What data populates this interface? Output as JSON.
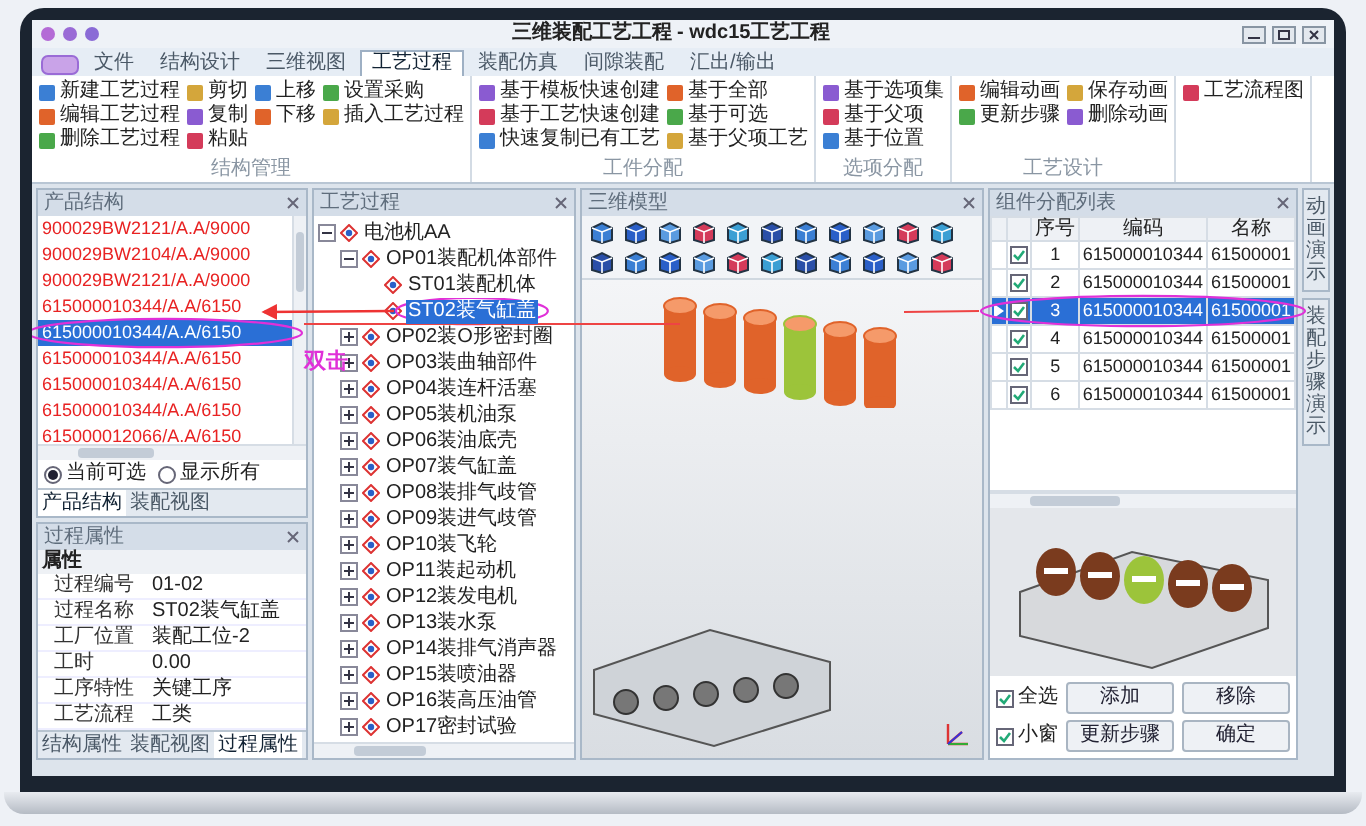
{
  "window": {
    "title": "三维装配工艺工程 - wdc15工艺工程"
  },
  "ribbon": {
    "tabs": [
      {
        "label": "文件",
        "selected": false
      },
      {
        "label": "结构设计",
        "selected": false
      },
      {
        "label": "三维视图",
        "selected": false
      },
      {
        "label": "工艺过程",
        "selected": true
      },
      {
        "label": "装配仿真",
        "selected": false
      },
      {
        "label": "间隙装配",
        "selected": false
      },
      {
        "label": "汇出/输出",
        "selected": false
      }
    ],
    "groups": [
      {
        "label": "结构管理",
        "columns": [
          [
            "新建工艺过程",
            "编辑工艺过程",
            "删除工艺过程"
          ],
          [
            "剪切",
            "复制",
            "粘贴"
          ],
          [
            "上移",
            "下移"
          ],
          [
            "设置采购",
            "插入工艺过程"
          ]
        ]
      },
      {
        "label": "工件分配",
        "columns": [
          [
            "基于模板快速创建",
            "基于工艺快速创建",
            "快速复制已有工艺"
          ],
          [
            "基于全部",
            "基于可选",
            "基于父项工艺"
          ]
        ]
      },
      {
        "label": "选项分配",
        "columns": [
          [
            "基于选项集",
            "基于父项",
            "基于位置"
          ]
        ]
      },
      {
        "label": "工艺设计",
        "columns": [
          [
            "编辑动画",
            "更新步骤"
          ],
          [
            "保存动画",
            "删除动画"
          ]
        ]
      },
      {
        "columns": [
          [
            "工艺流程图"
          ]
        ]
      }
    ]
  },
  "product_panel": {
    "title": "产品结构",
    "rows": [
      {
        "text": "900029BW2121/A.A/9000",
        "selected": false
      },
      {
        "text": "900029BW2104/A.A/9000",
        "selected": false
      },
      {
        "text": "900029BW2121/A.A/9000",
        "selected": false
      },
      {
        "text": "615000010344/A.A/6150",
        "selected": false
      },
      {
        "text": "615000010344/A.A/6150",
        "selected": true
      },
      {
        "text": "615000010344/A.A/6150",
        "selected": false
      },
      {
        "text": "615000010344/A.A/6150",
        "selected": false
      },
      {
        "text": "615000010344/A.A/6150",
        "selected": false
      },
      {
        "text": "615000012066/A.A/6150",
        "selected": false
      }
    ],
    "radios": [
      {
        "label": "当前可选",
        "selected": true
      },
      {
        "label": "显示所有",
        "selected": false
      }
    ],
    "tabs": [
      {
        "label": "产品结构",
        "selected": true
      },
      {
        "label": "装配视图",
        "selected": false
      }
    ]
  },
  "properties_panel": {
    "title": "过程属性",
    "category": "属性",
    "rows": [
      {
        "label": "过程编号",
        "value": "01-02"
      },
      {
        "label": "过程名称",
        "value": "ST02装气缸盖"
      },
      {
        "label": "工厂位置",
        "value": "装配工位-2"
      },
      {
        "label": "工时",
        "value": "0.00"
      },
      {
        "label": "工序特性",
        "value": "关键工序"
      },
      {
        "label": "工艺流程",
        "value": "工类"
      }
    ],
    "tabs": [
      {
        "label": "结构属性",
        "selected": false
      },
      {
        "label": "装配视图",
        "selected": false
      },
      {
        "label": "过程属性",
        "selected": true
      }
    ]
  },
  "process_panel": {
    "title": "工艺过程",
    "nodes": [
      {
        "label": "电池机AA",
        "expanded": true,
        "selected": false,
        "children": [
          {
            "label": "OP01装配机体部件",
            "expanded": true,
            "selected": false,
            "children": [
              {
                "label": "ST01装配机体",
                "selected": false
              },
              {
                "label": "ST02装气缸盖",
                "selected": true
              }
            ]
          },
          {
            "label": "OP02装O形密封圈",
            "expanded": false,
            "selected": false
          },
          {
            "label": "OP03装曲轴部件",
            "expanded": false,
            "selected": false
          },
          {
            "label": "OP04装连杆活塞",
            "expanded": false,
            "selected": false
          },
          {
            "label": "OP05装机油泵",
            "expanded": false,
            "selected": false
          },
          {
            "label": "OP06装油底壳",
            "expanded": false,
            "selected": false
          },
          {
            "label": "OP07装气缸盖",
            "expanded": false,
            "selected": false
          },
          {
            "label": "OP08装排气歧管",
            "expanded": false,
            "selected": false
          },
          {
            "label": "OP09装进气歧管",
            "expanded": false,
            "selected": false
          },
          {
            "label": "OP10装飞轮",
            "expanded": false,
            "selected": false
          },
          {
            "label": "OP11装起动机",
            "expanded": false,
            "selected": false
          },
          {
            "label": "OP12装发电机",
            "expanded": false,
            "selected": false
          },
          {
            "label": "OP13装水泵",
            "expanded": false,
            "selected": false
          },
          {
            "label": "OP14装排气消声器",
            "expanded": false,
            "selected": false
          },
          {
            "label": "OP15装喷油器",
            "expanded": false,
            "selected": false
          },
          {
            "label": "OP16装高压油管",
            "expanded": false,
            "selected": false
          },
          {
            "label": "OP17密封试验",
            "expanded": false,
            "selected": false
          }
        ]
      }
    ]
  },
  "model_panel": {
    "title": "三维模型"
  },
  "assignment_panel": {
    "title": "组件分配列表",
    "columns": [
      "序号",
      "编码",
      "名称"
    ],
    "rows": [
      {
        "checked": true,
        "no": "1",
        "code": "615000010344",
        "name": "61500001",
        "selected": false
      },
      {
        "checked": true,
        "no": "2",
        "code": "615000010344",
        "name": "61500001",
        "selected": false
      },
      {
        "checked": true,
        "no": "3",
        "code": "615000010344",
        "name": "61500001",
        "selected": true
      },
      {
        "checked": true,
        "no": "4",
        "code": "615000010344",
        "name": "61500001",
        "selected": false
      },
      {
        "checked": true,
        "no": "5",
        "code": "615000010344",
        "name": "61500001",
        "selected": false
      },
      {
        "checked": true,
        "no": "6",
        "code": "615000010344",
        "name": "61500001",
        "selected": false
      }
    ],
    "options": [
      {
        "label": "全选",
        "checked": true
      },
      {
        "label": "小窗",
        "checked": true
      }
    ],
    "buttons": [
      "添加",
      "移除",
      "更新步骤",
      "确定"
    ]
  },
  "side_tabs": [
    {
      "label": "动画演示"
    },
    {
      "label": "装配步骤演示"
    }
  ],
  "annotation": {
    "label": "双击"
  }
}
